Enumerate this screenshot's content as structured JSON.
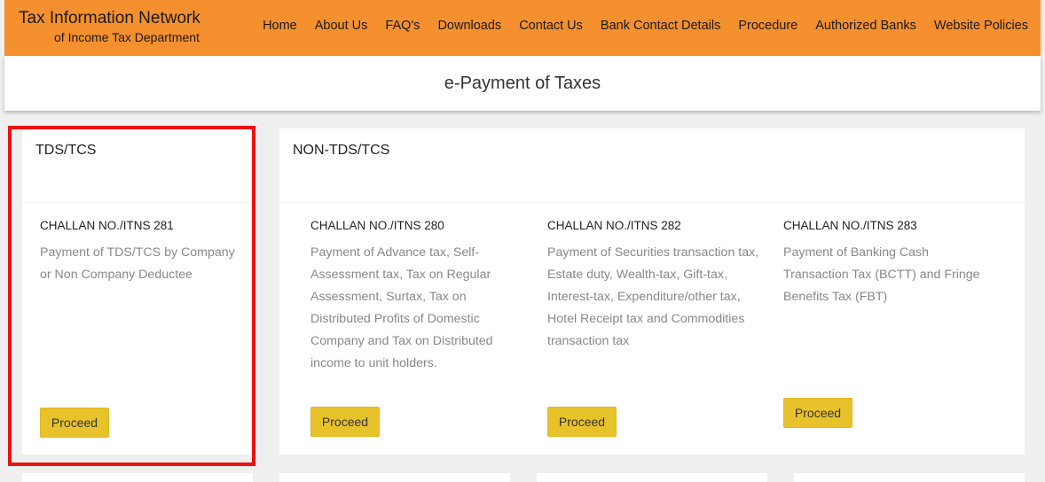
{
  "header": {
    "brand_title": "Tax Information Network",
    "brand_subtitle": "of Income Tax Department",
    "nav": [
      "Home",
      "About Us",
      "FAQ's",
      "Downloads",
      "Contact Us",
      "Bank Contact Details",
      "Procedure",
      "Authorized Banks",
      "Website Policies"
    ]
  },
  "page": {
    "title": "e-Payment of Taxes"
  },
  "tds": {
    "heading": "TDS/TCS",
    "challan": "CHALLAN NO./ITNS 281",
    "description": "Payment of TDS/TCS by Company or Non Company Deductee",
    "button": "Proceed"
  },
  "non_tds": {
    "heading": "NON-TDS/TCS",
    "items": [
      {
        "challan": "CHALLAN NO./ITNS 280",
        "description": "Payment of Advance tax, Self-Assessment tax, Tax on Regular Assessment, Surtax, Tax on Distributed Profits of Domestic Company and Tax on Distributed income to unit holders.",
        "button": "Proceed"
      },
      {
        "challan": "CHALLAN NO./ITNS 282",
        "description": "Payment of Securities transaction tax, Estate duty, Wealth-tax, Gift-tax, Interest-tax, Expenditure/other tax, Hotel Receipt tax and Commodities transaction tax",
        "button": "Proceed"
      },
      {
        "challan": "CHALLAN NO./ITNS 283",
        "description": "Payment of Banking Cash Transaction Tax (BCTT) and Fringe Benefits Tax (FBT)",
        "button": "Proceed"
      }
    ]
  },
  "colors": {
    "header_bg": "#f5902f",
    "button_bg": "#e8c22a",
    "highlight_border": "#ee1111",
    "page_bg": "#efefef"
  }
}
